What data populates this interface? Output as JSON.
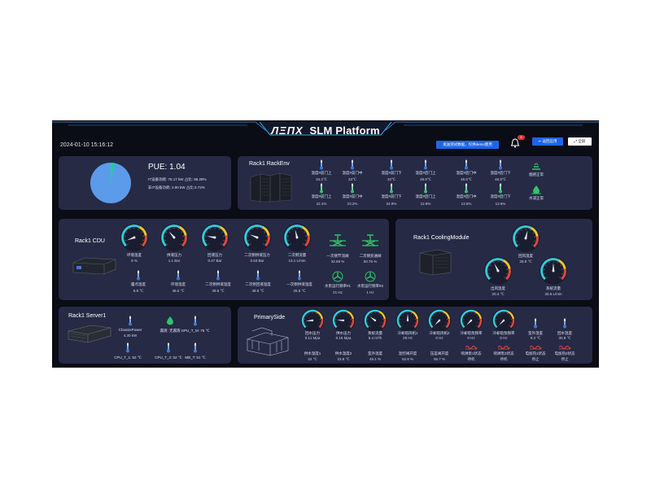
{
  "header": {
    "title_logo": "ЛΞΠX",
    "title_text": "SLM Platform",
    "datetime": "2024-01-10 15:16:12",
    "demo_notice": "发送测试数据，仅供demo使用",
    "notification_count": "8",
    "back_label": "返回应用",
    "fullscreen_label": "全屏"
  },
  "pue": {
    "label": "PUE: 1.04",
    "it_line": "IT设备功耗: 75.17 kW  占比: 96.28%",
    "nonit_line": "非IT设备功耗: 2.90 kW  占比:3.72%",
    "it_share": 0.9628,
    "colors": {
      "it": "#5b9bea",
      "nonit": "#2fc4a8"
    }
  },
  "rackenv": {
    "title": "Rack1 RackEnv",
    "sensors": [
      {
        "label": "温度#前门上",
        "value": "34.4℃"
      },
      {
        "label": "温度#前门中",
        "value": "33℃"
      },
      {
        "label": "温度#前门下",
        "value": "32℃"
      },
      {
        "label": "温度#后门上",
        "value": "48.8℃"
      },
      {
        "label": "温度#后门中",
        "value": "46.5℃"
      },
      {
        "label": "温度#后门下",
        "value": "46.9℃"
      }
    ],
    "humidity": [
      {
        "label": "湿度#前门上",
        "value": "22.1%"
      },
      {
        "label": "湿度#前门中",
        "value": "23.2%"
      },
      {
        "label": "湿度#前门下",
        "value": "24.9%"
      },
      {
        "label": "湿度#后门上",
        "value": "12.8%"
      },
      {
        "label": "湿度#后门中",
        "value": "13.5%"
      },
      {
        "label": "湿度#后门下",
        "value": "13.5%"
      }
    ],
    "status": [
      {
        "label": "烟感正常"
      },
      {
        "label": "水浸正常"
      }
    ]
  },
  "cdu": {
    "title": "Rack1 CDU",
    "gauges": [
      {
        "label": "环境温度",
        "value": "9 %",
        "fraction": 0.09
      },
      {
        "label": "供液压力",
        "value": "1.1 Bar",
        "fraction": 0.35
      },
      {
        "label": "回液压力",
        "value": "0.47 Bar",
        "fraction": 0.2
      },
      {
        "label": "二次侧供液压力",
        "value": "0.63 Bar",
        "fraction": 0.25
      },
      {
        "label": "二次侧流量",
        "value": "13.1 L/min",
        "fraction": 0.45
      }
    ],
    "valves": [
      {
        "label": "一次侧节流阀",
        "value": "32.58 %"
      },
      {
        "label": "二次侧旁通阀",
        "value": "50.76 %"
      }
    ],
    "temps": [
      {
        "label": "露点温度",
        "value": "6.8 ℃"
      },
      {
        "label": "环境温度",
        "value": "46.6 ℃"
      },
      {
        "label": "二次侧供液温度",
        "value": "39.8 ℃"
      },
      {
        "label": "二次侧回液温度",
        "value": "48.9 ℃"
      },
      {
        "label": "一次侧供液温度",
        "value": "26.6 ℃"
      }
    ],
    "pumps": [
      {
        "label": "水泵运行频率#1",
        "value": "21 Hz"
      },
      {
        "label": "水泵运行频率#2",
        "value": "1 Hz"
      }
    ]
  },
  "cooling": {
    "title": "Rack1 CoolingModule",
    "gauges": [
      {
        "label": "回风温度",
        "value": "28.8 ℃",
        "fraction": 0.55
      },
      {
        "label": "出风温度",
        "value": "20.4 ℃",
        "fraction": 0.4
      },
      {
        "label": "系统流量",
        "value": "30.6 L/min",
        "fraction": 0.5
      }
    ]
  },
  "server": {
    "title": "Rack1 Server1",
    "chassis_power": {
      "label": "ChassisPower",
      "value": "4.30 kW"
    },
    "leak": {
      "label": "漏液: 无漏液"
    },
    "temps": [
      {
        "label": "GPU_T_M: 75 ℃"
      },
      {
        "label": "CPU_T_1: 52 ℃"
      },
      {
        "label": "CPU_T_2: 52 ℃"
      },
      {
        "label": "MB_T: 51 ℃"
      }
    ]
  },
  "primary": {
    "title": "PrimarySide",
    "gauges": [
      {
        "label": "回水压力",
        "value": "0.11 Mpa",
        "fraction": 0.15
      },
      {
        "label": "供水压力",
        "value": "0.15 Mpa",
        "fraction": 0.18
      },
      {
        "label": "系统流量",
        "value": "5.4 m³/h",
        "fraction": 0.3
      },
      {
        "label": "冷却塔风机1",
        "value": "25 Hz",
        "fraction": 0.5
      },
      {
        "label": "冷却塔风机2",
        "value": "0 Hz",
        "fraction": 0.0
      },
      {
        "label": "冷却塔泵频率",
        "value": "0 Hz",
        "fraction": 0.0
      },
      {
        "label": "冷却塔泵频率",
        "value": "0 Hz",
        "fraction": 0.0
      }
    ],
    "gauges_row2": [
      {
        "label": "供水温度1",
        "value": "22 ℃",
        "fraction": 0.3
      },
      {
        "label": "供水温度2",
        "value": "23.8 ℃",
        "fraction": 0.33
      },
      {
        "label": "室外温度",
        "value": "45.1 %",
        "fraction": 0.45
      },
      {
        "label": "温控阀开度",
        "value": "52.8 %",
        "fraction": 0.53
      },
      {
        "label": "压差阀开度",
        "value": "55.7 %",
        "fraction": 0.56
      }
    ],
    "temps": [
      {
        "label": "室外湿度",
        "value": "9.3 ℃"
      },
      {
        "label": "回水温度",
        "value": "30.8 ℃"
      }
    ],
    "status": [
      {
        "label": "喷淋泵1状态",
        "value": "待机"
      },
      {
        "label": "喷淋泵2状态",
        "value": "待机"
      },
      {
        "label": "电加热1状态",
        "value": "停止"
      },
      {
        "label": "电加热2状态",
        "value": "停止"
      }
    ]
  }
}
